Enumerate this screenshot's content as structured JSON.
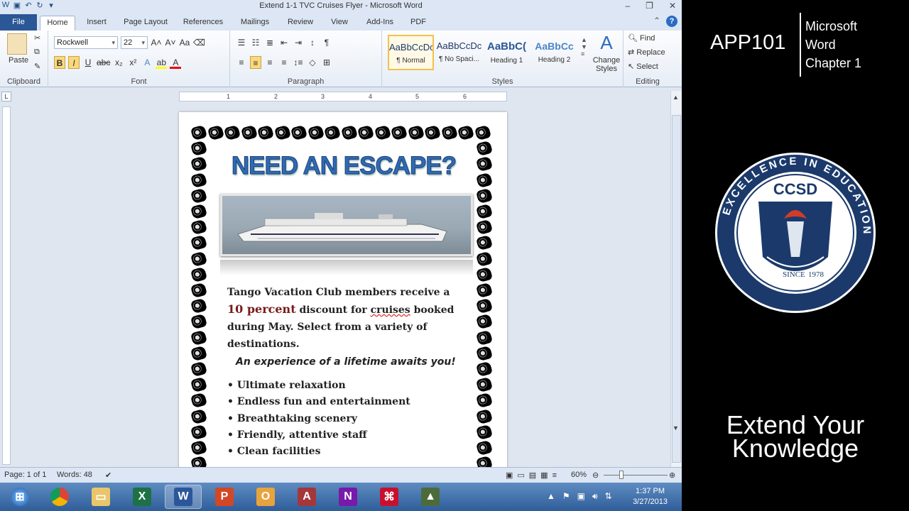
{
  "window": {
    "title": "Extend 1-1 TVC Cruises Flyer - Microsoft Word"
  },
  "tabs": [
    "File",
    "Home",
    "Insert",
    "Page Layout",
    "References",
    "Mailings",
    "Review",
    "View",
    "Add-Ins",
    "PDF"
  ],
  "ribbon": {
    "clipboard": {
      "paste": "Paste",
      "label": "Clipboard"
    },
    "font": {
      "name": "Rockwell",
      "size": "22",
      "label": "Font"
    },
    "paragraph": {
      "label": "Paragraph"
    },
    "styles": {
      "label": "Styles",
      "items": [
        {
          "preview": "AaBbCcDc",
          "name": "¶ Normal"
        },
        {
          "preview": "AaBbCcDc",
          "name": "¶ No Spaci..."
        },
        {
          "preview": "AaBbC(",
          "name": "Heading 1"
        },
        {
          "preview": "AaBbCc",
          "name": "Heading 2"
        }
      ],
      "change_styles": "Change Styles"
    },
    "editing": {
      "find": "Find",
      "replace": "Replace",
      "select": "Select",
      "label": "Editing"
    }
  },
  "ruler": {
    "marks": [
      "1",
      "2",
      "3",
      "4",
      "5",
      "6"
    ]
  },
  "document": {
    "headline": "NEED AN ESCAPE?",
    "para_a": "Tango Vacation Club members receive a ",
    "percent": "10 percent",
    "para_b": " discount for ",
    "cruises": "cruises",
    "para_c": " booked during May. Select from a variety of destinations.",
    "tagline": "An experience of a lifetime awaits you!",
    "bullets": [
      "Ultimate relaxation",
      "Endless fun and entertainment",
      "Breathtaking scenery",
      "Friendly, attentive staff",
      "Clean facilities"
    ]
  },
  "status": {
    "page": "Page: 1 of 1",
    "words": "Words: 48",
    "zoom": "60%"
  },
  "taskbar": {
    "time": "1:37 PM",
    "date": "3/27/2013"
  },
  "overlay": {
    "course": "APP101",
    "chapter_lines": [
      "Microsoft",
      "Word",
      "Chapter 1"
    ],
    "seal_top": "EXCELLENCE IN EDUCATION",
    "seal_name": "CCSD",
    "seal_since": "SINCE",
    "seal_year": "1978",
    "extend_lines": [
      "Extend Your",
      "Knowledge"
    ]
  },
  "colors": {
    "accent": "#2b5797",
    "headline": "#2f6bb5",
    "percent": "#7a1b1b"
  }
}
